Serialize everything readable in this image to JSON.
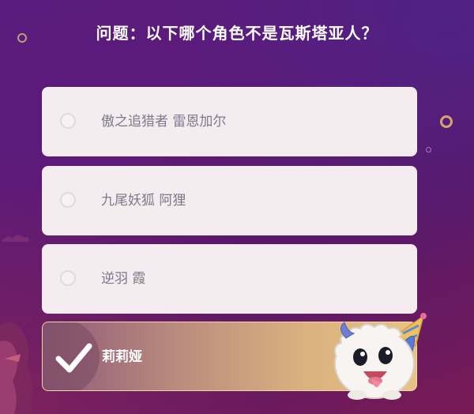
{
  "quiz": {
    "question": "问题：以下哪个角色不是瓦斯塔亚人？",
    "options": [
      {
        "label": "傲之追猎者 雷恩加尔",
        "selected": false
      },
      {
        "label": "九尾妖狐 阿狸",
        "selected": false
      },
      {
        "label": "逆羽 霞",
        "selected": false
      },
      {
        "label": "莉莉娅",
        "selected": true
      }
    ]
  },
  "icons": {
    "radio": "radio-circle-icon",
    "selected": "checkmark-icon",
    "mascot": "poro-mascot-icon"
  },
  "colors": {
    "background": "#5d1a78",
    "option_bg": "#f4ecef",
    "option_text": "#7d7a8a",
    "selected_gradient_start": "#8e5a78",
    "selected_gradient_end": "#e8c382",
    "accent_ring": "#d8a26a"
  }
}
